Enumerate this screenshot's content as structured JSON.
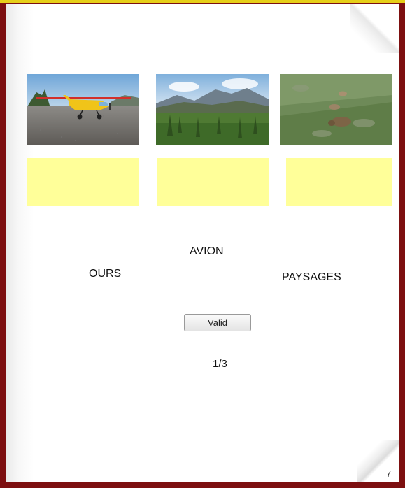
{
  "frame": {
    "border_color": "#7d0f10",
    "top_stripe_color": "#e6cf18"
  },
  "images": [
    {
      "name": "yellow-plane-photo",
      "depicts": "yellow bush plane on gravel airstrip"
    },
    {
      "name": "mountain-landscape-photo",
      "depicts": "mountains and forest landscape"
    },
    {
      "name": "bears-photo",
      "depicts": "bears grazing on green hillside"
    }
  ],
  "drop_zone_color": "#ffff99",
  "words": {
    "avion": "AVION",
    "ours": "OURS",
    "paysages": "PAYSAGES"
  },
  "controls": {
    "valid_label": "Valid"
  },
  "progress": {
    "text": "1/3"
  },
  "page_number": "7"
}
